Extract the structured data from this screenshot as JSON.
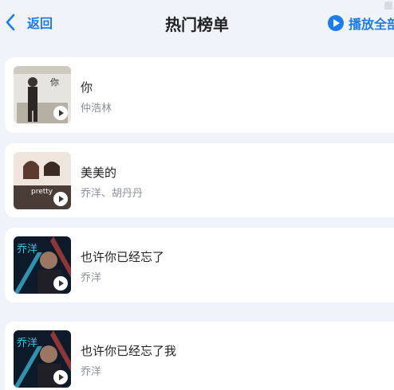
{
  "header": {
    "back_label": "返回",
    "title": "热门榜单",
    "play_all_label": "播放全部"
  },
  "songs": [
    {
      "title": "你",
      "artist": "仲浩林",
      "cover_text": "你"
    },
    {
      "title": "美美的",
      "artist": "乔洋、胡丹丹",
      "cover_text": "pretty"
    },
    {
      "title": "也许你已经忘了",
      "artist": "乔洋",
      "cover_text": "乔洋"
    },
    {
      "title": "也许你已经忘了我",
      "artist": "乔洋",
      "cover_text": "乔洋"
    }
  ],
  "colors": {
    "accent": "#1a7cf0",
    "background": "#f0f3fa",
    "card": "#ffffff"
  }
}
